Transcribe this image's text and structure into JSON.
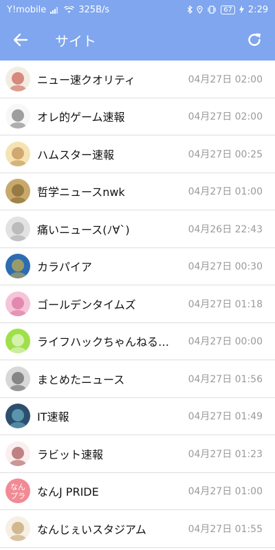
{
  "status_bar": {
    "carrier": "Y!mobile",
    "speed": "325B/s",
    "battery": "67",
    "time": "2:29"
  },
  "app_bar": {
    "title": "サイト",
    "back_icon": "arrow-left-icon",
    "refresh_icon": "refresh-icon",
    "color": "#7fa6ee"
  },
  "sites": [
    {
      "name": "ニュー速クオリティ",
      "time": "04月27日 02:00",
      "avatar_color": "#f3ece2",
      "avatar_accent": "#c0392b"
    },
    {
      "name": "オレ的ゲーム速報",
      "time": "04月27日 02:00",
      "avatar_color": "#f7f7f7",
      "avatar_accent": "#555555"
    },
    {
      "name": "ハムスター速報",
      "time": "04月27日 00:25",
      "avatar_color": "#f5e3b3",
      "avatar_accent": "#b07a3a"
    },
    {
      "name": "哲学ニュースnwk",
      "time": "04月27日 01:00",
      "avatar_color": "#c9a96b",
      "avatar_accent": "#6e5223"
    },
    {
      "name": "痛いニュース(ﾉ∀`)",
      "time": "04月26日 22:43",
      "avatar_color": "#e2e2e2",
      "avatar_accent": "#9a9a9a"
    },
    {
      "name": "カラパイア",
      "time": "04月27日 00:30",
      "avatar_color": "#2d6cb3",
      "avatar_accent": "#f2c230"
    },
    {
      "name": "ゴールデンタイムズ",
      "time": "04月27日 01:18",
      "avatar_color": "#f5c4d8",
      "avatar_accent": "#d45a8f"
    },
    {
      "name": "ライフハックちゃんねる弐式",
      "time": "04月27日 00:00",
      "avatar_color": "#9fe04a",
      "avatar_accent": "#ffffff"
    },
    {
      "name": "まとめたニュース",
      "time": "04月27日 01:56",
      "avatar_color": "#d8d8d8",
      "avatar_accent": "#444444"
    },
    {
      "name": "IT速報",
      "time": "04月27日 01:49",
      "avatar_color": "#2d4f6e",
      "avatar_accent": "#7fd0e0"
    },
    {
      "name": "ラビット速報",
      "time": "04月27日 01:23",
      "avatar_color": "#fbeeee",
      "avatar_accent": "#8e2a2a"
    },
    {
      "name": "なんJ PRIDE",
      "time": "04月27日 01:00",
      "avatar_color": "#f08a95",
      "avatar_accent": "#ffffff",
      "avatar_text": "なん\nプラ"
    },
    {
      "name": "なんじぇいスタジアム",
      "time": "04月27日 01:55",
      "avatar_color": "#f6efe3",
      "avatar_accent": "#b58a4a"
    }
  ]
}
